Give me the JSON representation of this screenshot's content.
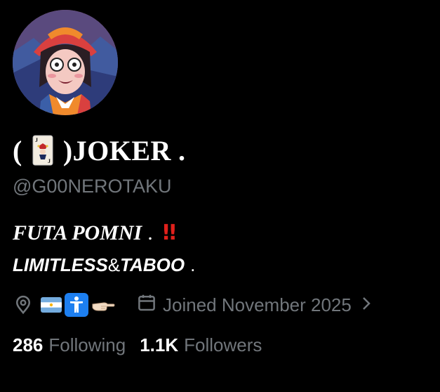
{
  "profile": {
    "avatar_alt": "profile avatar",
    "name_prefix": "(",
    "name_suffix": ")JOKER",
    "name_dot": ".",
    "handle": "@G00NEROTAKU",
    "bio": {
      "line1_text": "FUTA POMNI",
      "line1_dot": ".",
      "line1_mark": "!!",
      "line2_a": "LIMITLESS",
      "line2_amp": "&",
      "line2_b": "TABOO",
      "line2_dot": "."
    },
    "joined": "Joined November 2025",
    "following_count": "286",
    "following_label": "Following",
    "followers_count": "1.1K",
    "followers_label": "Followers"
  },
  "icons": {
    "location": "location-pin-icon",
    "flag": "argentina-flag-icon",
    "accessibility": "accessibility-icon",
    "hand": "pointing-hand-icon",
    "calendar": "calendar-icon",
    "chevron": "chevron-right-icon",
    "card": "joker-card-icon"
  },
  "colors": {
    "background": "#000000",
    "primary_text": "#ffffff",
    "secondary_text": "#71767b",
    "accent_red": "#e0201b",
    "accessibility_blue": "#1d7ff0"
  }
}
